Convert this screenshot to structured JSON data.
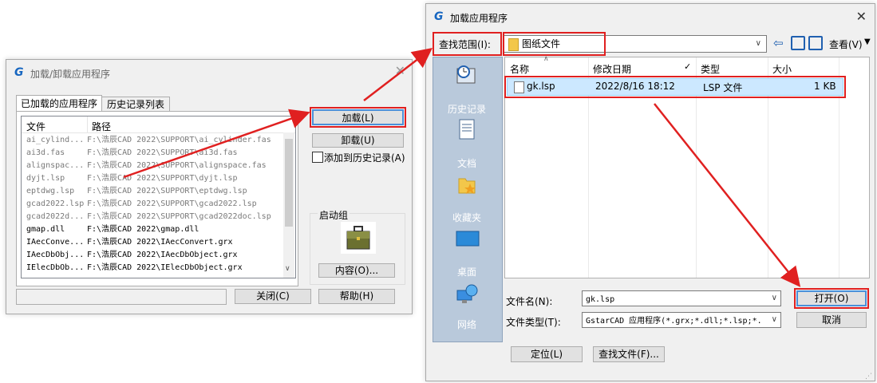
{
  "left_dialog": {
    "title": "加载/卸载应用程序",
    "logo": "G",
    "tabs": [
      {
        "label": "已加载的应用程序"
      },
      {
        "label": "历史记录列表"
      }
    ],
    "columns": [
      "文件",
      "路径"
    ],
    "rows": [
      {
        "file": "ai_cylind...",
        "path": "F:\\浩辰CAD 2022\\SUPPORT\\ai_cylinder.fas",
        "gray": true
      },
      {
        "file": "ai3d.fas",
        "path": "F:\\浩辰CAD 2022\\SUPPORT\\ai3d.fas",
        "gray": true
      },
      {
        "file": "alignspac...",
        "path": "F:\\浩辰CAD 2022\\SUPPORT\\alignspace.fas",
        "gray": true
      },
      {
        "file": "dyjt.lsp",
        "path": "F:\\浩辰CAD 2022\\SUPPORT\\dyjt.lsp",
        "gray": true
      },
      {
        "file": "eptdwg.lsp",
        "path": "F:\\浩辰CAD 2022\\SUPPORT\\eptdwg.lsp",
        "gray": true
      },
      {
        "file": "gcad2022.lsp",
        "path": "F:\\浩辰CAD 2022\\SUPPORT\\gcad2022.lsp",
        "gray": true
      },
      {
        "file": "gcad2022d...",
        "path": "F:\\浩辰CAD 2022\\SUPPORT\\gcad2022doc.lsp",
        "gray": true
      },
      {
        "file": "gmap.dll",
        "path": "F:\\浩辰CAD 2022\\gmap.dll",
        "gray": false
      },
      {
        "file": "IAecConve...",
        "path": "F:\\浩辰CAD 2022\\IAecConvert.grx",
        "gray": false
      },
      {
        "file": "IAecDbObj...",
        "path": "F:\\浩辰CAD 2022\\IAecDbObject.grx",
        "gray": false
      },
      {
        "file": "IElecDbOb...",
        "path": "F:\\浩辰CAD 2022\\IElecDbObject.grx",
        "gray": false
      }
    ],
    "load_label": "加载(L)",
    "unload_label": "卸载(U)",
    "add_history_label": "添加到历史记录(A)",
    "startup_group_label": "启动组",
    "contents_label": "内容(O)...",
    "close_label": "关闭(C)",
    "help_label": "帮助(H)"
  },
  "right_dialog": {
    "title": "加载应用程序",
    "logo": "G",
    "look_in_label": "查找范围(I):",
    "look_in_value": "图纸文件",
    "view_label": "查看(V)",
    "places": [
      {
        "label": "历史记录",
        "icon": "history-icon"
      },
      {
        "label": "文档",
        "icon": "documents-icon"
      },
      {
        "label": "收藏夹",
        "icon": "favorites-folder-icon"
      },
      {
        "label": "桌面",
        "icon": "desktop-icon"
      },
      {
        "label": "网络",
        "icon": "network-icon"
      }
    ],
    "columns": [
      "名称",
      "修改日期",
      "类型",
      "大小"
    ],
    "files": [
      {
        "name": "gk.lsp",
        "date": "2022/8/16 18:12",
        "type": "LSP 文件",
        "size": "1 KB"
      }
    ],
    "filename_label": "文件名(N):",
    "filename_value": "gk.lsp",
    "filetype_label": "文件类型(T):",
    "filetype_value": "GstarCAD 应用程序(*.grx;*.dll;*.lsp;*.",
    "open_label": "打开(O)",
    "cancel_label": "取消",
    "locate_label": "定位(L)",
    "find_file_label": "查找文件(F)..."
  },
  "colors": {
    "annotation_red": "#e02020",
    "selection_blue": "#cce8ff",
    "places_bar": "#b9c9db",
    "logo_blue": "#1565c0"
  }
}
